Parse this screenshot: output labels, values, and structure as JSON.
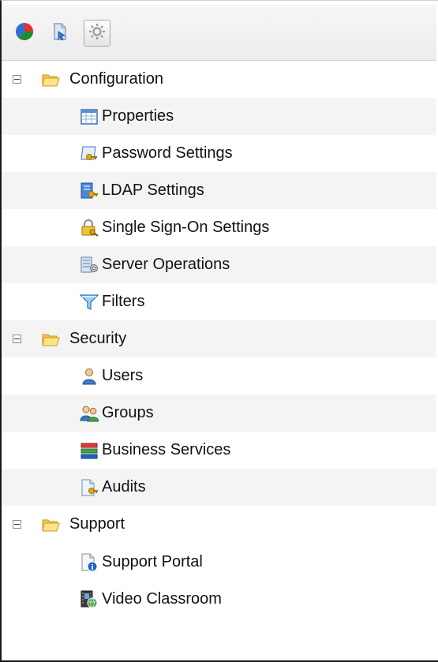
{
  "toolbar": {
    "buttons": [
      {
        "icon": "pie-chart-icon"
      },
      {
        "icon": "document-arrow-icon"
      },
      {
        "icon": "gear-icon",
        "active": true
      }
    ]
  },
  "tree": {
    "groups": [
      {
        "label": "Configuration",
        "items": [
          {
            "label": "Properties",
            "icon": "properties-grid-icon"
          },
          {
            "label": "Password Settings",
            "icon": "password-key-icon"
          },
          {
            "label": "LDAP Settings",
            "icon": "ldap-icon"
          },
          {
            "label": "Single Sign-On Settings",
            "icon": "lock-key-icon"
          },
          {
            "label": "Server Operations",
            "icon": "server-operations-icon"
          },
          {
            "label": "Filters",
            "icon": "filter-icon"
          }
        ]
      },
      {
        "label": "Security",
        "items": [
          {
            "label": "Users",
            "icon": "user-icon"
          },
          {
            "label": "Groups",
            "icon": "groups-icon"
          },
          {
            "label": "Business Services",
            "icon": "business-services-icon"
          },
          {
            "label": "Audits",
            "icon": "audit-document-icon"
          }
        ]
      },
      {
        "label": "Support",
        "items": [
          {
            "label": "Support Portal",
            "icon": "support-portal-icon"
          },
          {
            "label": "Video Classroom",
            "icon": "video-classroom-icon"
          }
        ]
      }
    ]
  }
}
